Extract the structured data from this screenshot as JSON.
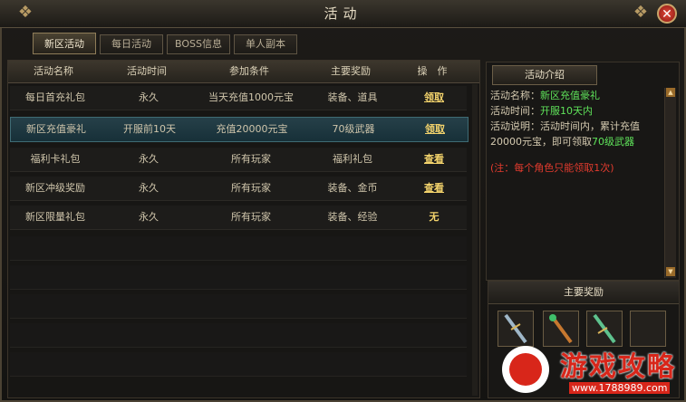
{
  "window": {
    "title": "活动"
  },
  "tabs": [
    "新区活动",
    "每日活动",
    "BOSS信息",
    "单人副本"
  ],
  "table": {
    "headers": [
      "活动名称",
      "活动时间",
      "参加条件",
      "主要奖励",
      "操　作"
    ],
    "rows": [
      {
        "name": "每日首充礼包",
        "time": "永久",
        "condition": "当天充值1000元宝",
        "reward": "装备、道具",
        "action": "领取"
      },
      {
        "name": "新区充值豪礼",
        "time": "开服前10天",
        "condition": "充值20000元宝",
        "reward": "70级武器",
        "action": "领取"
      },
      {
        "name": "福利卡礼包",
        "time": "永久",
        "condition": "所有玩家",
        "reward": "福利礼包",
        "action": "查看"
      },
      {
        "name": "新区冲级奖励",
        "time": "永久",
        "condition": "所有玩家",
        "reward": "装备、金币",
        "action": "查看"
      },
      {
        "name": "新区限量礼包",
        "time": "永久",
        "condition": "所有玩家",
        "reward": "装备、经验",
        "action": "无"
      }
    ]
  },
  "side": {
    "title": "活动介绍",
    "name_label": "活动名称：",
    "name_value": "新区充值豪礼",
    "time_label": "活动时间：",
    "time_value": "开服10天内",
    "desc_label": "活动说明：活动时间内，累计充值20000元宝，即可领取",
    "desc_value": "70级武器",
    "note": "(注：每个角色只能领取1次)"
  },
  "rewards": {
    "title": "主要奖励"
  },
  "watermark": {
    "text": "游戏攻略",
    "url": "www.1788989.com"
  },
  "colors": {
    "highlight": "#5fe35a",
    "note": "#e23b2e",
    "action": "#f3d36c"
  }
}
